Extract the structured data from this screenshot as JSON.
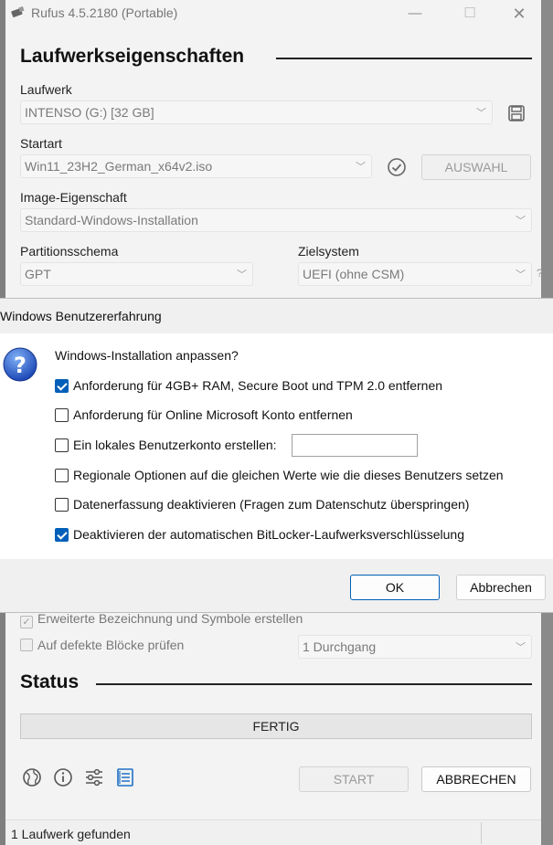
{
  "window": {
    "title": "Rufus 4.5.2180 (Portable)"
  },
  "drive_props": {
    "section_title": "Laufwerkseigenschaften",
    "drive_label": "Laufwerk",
    "drive_value": "INTENSO (G:) [32 GB]",
    "boot_label": "Startart",
    "boot_value": "Win11_23H2_German_x64v2.iso",
    "select_button": "AUSWAHL",
    "image_label": "Image-Eigenschaft",
    "image_value": "Standard-Windows-Installation",
    "partition_label": "Partitionsschema",
    "partition_value": "GPT",
    "target_label": "Zielsystem",
    "target_value": "UEFI (ohne CSM)",
    "help_mark": "?"
  },
  "format_options": {
    "extended_label": "Erweiterte Bezeichnung und Symbole erstellen",
    "bad_blocks_label": "Auf defekte Blöcke prüfen",
    "passes_value": "1 Durchgang"
  },
  "status": {
    "section_title": "Status",
    "progress_text": "FERTIG",
    "progress_percent": 100,
    "start_button": "START",
    "cancel_button": "ABBRECHEN",
    "statusbar_text": "1 Laufwerk gefunden"
  },
  "dialog": {
    "title": "Windows Benutzererfahrung",
    "question": "Windows-Installation anpassen?",
    "options": [
      {
        "label": "Anforderung für 4GB+ RAM, Secure Boot und TPM 2.0 entfernen",
        "checked": true
      },
      {
        "label": "Anforderung für Online Microsoft Konto entfernen",
        "checked": false
      },
      {
        "label": "Ein lokales Benutzerkonto erstellen:",
        "checked": false
      },
      {
        "label": "Regionale Optionen auf die gleichen Werte wie die dieses Benutzers setzen",
        "checked": false
      },
      {
        "label": "Datenerfassung deaktivieren (Fragen zum Datenschutz überspringen)",
        "checked": false
      },
      {
        "label": "Deaktivieren der automatischen BitLocker-Laufwerksverschlüsselung",
        "checked": true
      }
    ],
    "username_value": "",
    "ok_button": "OK",
    "cancel_button": "Abbrechen"
  },
  "colors": {
    "accent": "#005fb8",
    "dialog_background": "#f0f0f0",
    "window_background": "#f3f3f3"
  },
  "icons": {
    "app": "usb-drive-icon",
    "save": "save-icon",
    "verify": "check-circle-icon",
    "question": "question-icon",
    "language": "globe-icon",
    "about": "info-icon",
    "settings": "sliders-icon",
    "log": "log-icon"
  }
}
